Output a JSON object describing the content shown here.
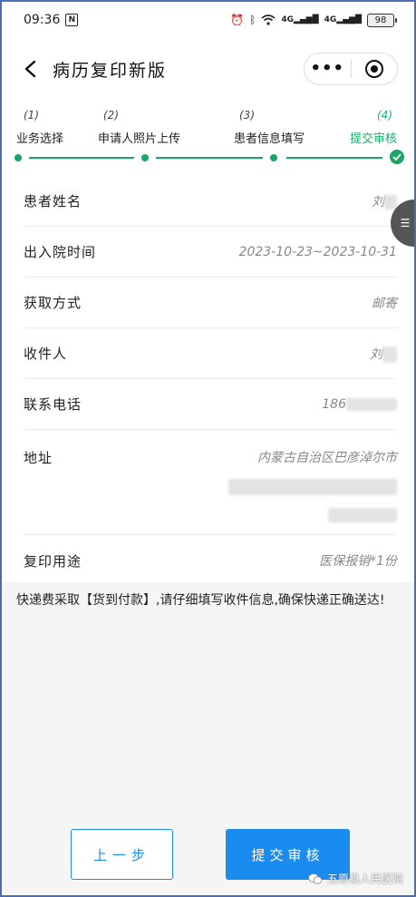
{
  "status_bar": {
    "time": "09:36",
    "signal_1": "4G",
    "signal_2": "4G",
    "battery": "98"
  },
  "nav": {
    "title": "病历复印新版"
  },
  "steps": [
    {
      "num": "(1)",
      "label": "业务选择"
    },
    {
      "num": "(2)",
      "label": "申请人照片上传"
    },
    {
      "num": "(3)",
      "label": "患者信息填写"
    },
    {
      "num": "(4)",
      "label": "提交审核"
    }
  ],
  "form": {
    "patient_name_label": "患者姓名",
    "patient_name_value": "刘",
    "stay_period_label": "出入院时间",
    "stay_period_value": "2023-10-23~2023-10-31",
    "pickup_method_label": "获取方式",
    "pickup_method_value": "邮寄",
    "recipient_label": "收件人",
    "recipient_value": "刘",
    "phone_label": "联系电话",
    "phone_value": "186",
    "address_label": "地址",
    "address_value": "内蒙古自治区巴彦淖尔市",
    "purpose_label": "复印用途",
    "purpose_value": "医保报销*1份"
  },
  "notice": "快递费采取【货到付款】,请仔细填写收件信息,确保快递正确送达!",
  "buttons": {
    "prev": "上一步",
    "submit": "提交审核"
  },
  "watermark": "五原县人民医院",
  "colors": {
    "accent": "#1a8cf0",
    "step_green": "#1aa568"
  }
}
